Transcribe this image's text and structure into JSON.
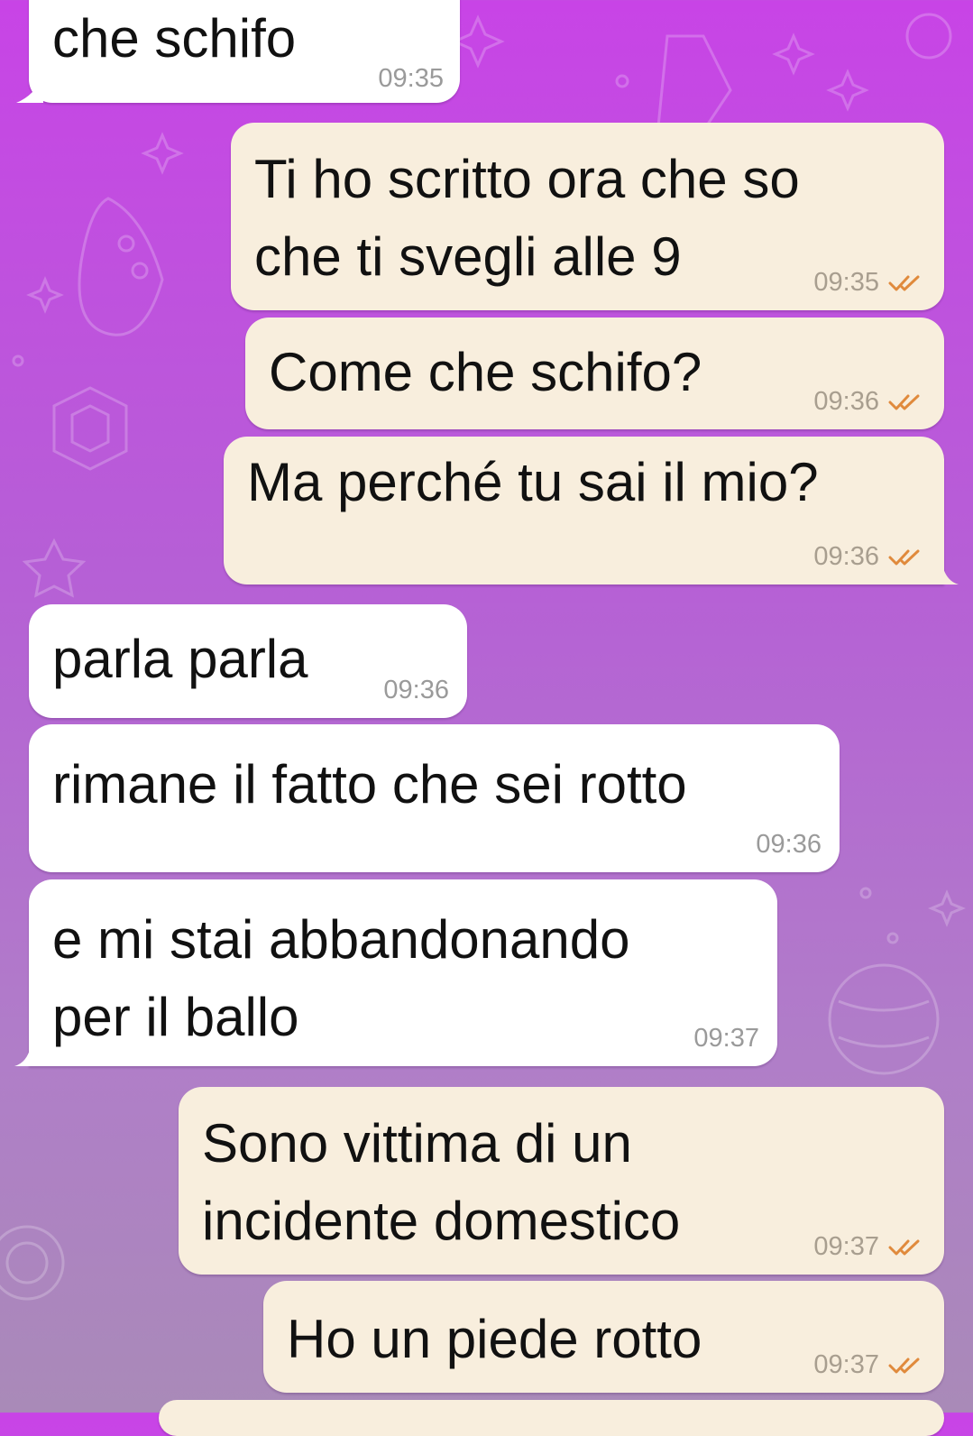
{
  "theme": {
    "incoming_bubble": "#ffffff",
    "outgoing_bubble": "#f8eedd",
    "read_tick_color": "#e08a3c",
    "background_top": "#c844e6",
    "background_bottom": "#a98ab8"
  },
  "messages": [
    {
      "id": "m1",
      "direction": "incoming",
      "text": "che schifo",
      "time": "09:35"
    },
    {
      "id": "m2",
      "direction": "outgoing",
      "text": "Ti ho scritto ora che so\nche ti svegli alle 9",
      "time": "09:35",
      "status_icon": "double-check-icon"
    },
    {
      "id": "m3",
      "direction": "outgoing",
      "text": "Come che schifo?",
      "time": "09:36",
      "status_icon": "double-check-icon"
    },
    {
      "id": "m4",
      "direction": "outgoing",
      "text": "Ma perché tu sai il mio?",
      "time": "09:36",
      "status_icon": "double-check-icon"
    },
    {
      "id": "m5",
      "direction": "incoming",
      "text": "parla parla",
      "time": "09:36"
    },
    {
      "id": "m6",
      "direction": "incoming",
      "text": "rimane il fatto che sei rotto",
      "time": "09:36"
    },
    {
      "id": "m7",
      "direction": "incoming",
      "text": "e mi stai abbandonando\nper il ballo",
      "time": "09:37"
    },
    {
      "id": "m8",
      "direction": "outgoing",
      "text": "Sono vittima di un\nincidente domestico",
      "time": "09:37",
      "status_icon": "double-check-icon"
    },
    {
      "id": "m9",
      "direction": "outgoing",
      "text": "Ho un piede rotto",
      "time": "09:37",
      "status_icon": "double-check-icon"
    }
  ]
}
